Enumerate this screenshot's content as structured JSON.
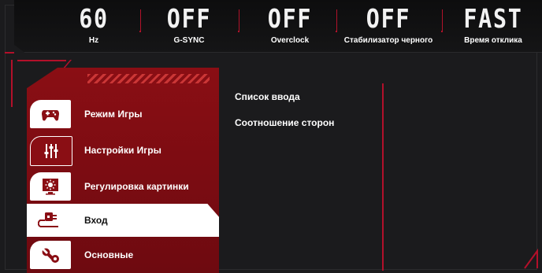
{
  "status": [
    {
      "value": "60",
      "caption": "Hz"
    },
    {
      "value": "OFF",
      "caption": "G-SYNC"
    },
    {
      "value": "OFF",
      "caption": "Overclock"
    },
    {
      "value": "OFF",
      "caption": "Стабилизатор черного"
    },
    {
      "value": "FAST",
      "caption": "Время отклика"
    }
  ],
  "menu": [
    {
      "label": "Режим Игры",
      "icon": "gamepad-icon"
    },
    {
      "label": "Настройки Игры",
      "icon": "sliders-icon"
    },
    {
      "label": "Регулировка картинки",
      "icon": "monitor-brightness-icon"
    },
    {
      "label": "Вход",
      "icon": "input-plug-icon",
      "selected": true
    },
    {
      "label": "Основные",
      "icon": "wrench-gear-icon"
    }
  ],
  "submenu": [
    "Список ввода",
    "Соотношение сторон"
  ],
  "colors": {
    "accent": "#b3102a",
    "panel": "#8a0e14",
    "background": "#1b1b1d"
  }
}
